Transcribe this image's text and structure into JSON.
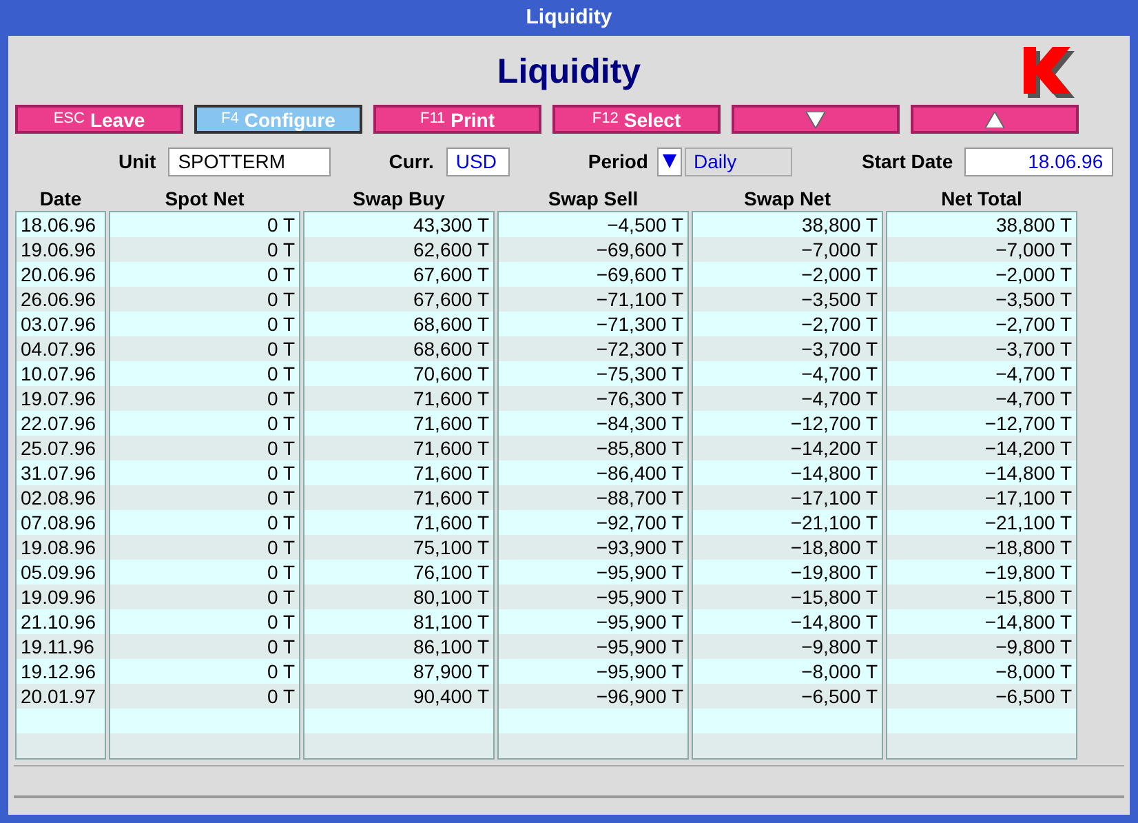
{
  "window": {
    "title": "Liquidity"
  },
  "heading": "Liquidity",
  "buttons": [
    {
      "kind": "text",
      "key": "ESC",
      "label": "Leave",
      "selected": false
    },
    {
      "kind": "text",
      "key": "F4",
      "label": "Configure",
      "selected": true
    },
    {
      "kind": "text",
      "key": "F11",
      "label": "Print",
      "selected": false
    },
    {
      "kind": "text",
      "key": "F12",
      "label": "Select",
      "selected": false
    },
    {
      "kind": "down",
      "selected": false
    },
    {
      "kind": "up",
      "selected": false
    }
  ],
  "fields": {
    "unit": {
      "label": "Unit",
      "value": "SPOTTERM"
    },
    "currency": {
      "label": "Curr.",
      "value": "USD"
    },
    "period": {
      "label": "Period",
      "value": "Daily"
    },
    "start_date": {
      "label": "Start Date",
      "value": "18.06.96"
    }
  },
  "table": {
    "columns": [
      "Date",
      "Spot Net",
      "Swap Buy",
      "Swap Sell",
      "Swap Net",
      "Net Total"
    ],
    "rows": [
      [
        "18.06.96",
        "0 T",
        "43,300 T",
        "−4,500 T",
        "38,800 T",
        "38,800 T"
      ],
      [
        "19.06.96",
        "0 T",
        "62,600 T",
        "−69,600 T",
        "−7,000 T",
        "−7,000 T"
      ],
      [
        "20.06.96",
        "0 T",
        "67,600 T",
        "−69,600 T",
        "−2,000 T",
        "−2,000 T"
      ],
      [
        "26.06.96",
        "0 T",
        "67,600 T",
        "−71,100 T",
        "−3,500 T",
        "−3,500 T"
      ],
      [
        "03.07.96",
        "0 T",
        "68,600 T",
        "−71,300 T",
        "−2,700 T",
        "−2,700 T"
      ],
      [
        "04.07.96",
        "0 T",
        "68,600 T",
        "−72,300 T",
        "−3,700 T",
        "−3,700 T"
      ],
      [
        "10.07.96",
        "0 T",
        "70,600 T",
        "−75,300 T",
        "−4,700 T",
        "−4,700 T"
      ],
      [
        "19.07.96",
        "0 T",
        "71,600 T",
        "−76,300 T",
        "−4,700 T",
        "−4,700 T"
      ],
      [
        "22.07.96",
        "0 T",
        "71,600 T",
        "−84,300 T",
        "−12,700 T",
        "−12,700 T"
      ],
      [
        "25.07.96",
        "0 T",
        "71,600 T",
        "−85,800 T",
        "−14,200 T",
        "−14,200 T"
      ],
      [
        "31.07.96",
        "0 T",
        "71,600 T",
        "−86,400 T",
        "−14,800 T",
        "−14,800 T"
      ],
      [
        "02.08.96",
        "0 T",
        "71,600 T",
        "−88,700 T",
        "−17,100 T",
        "−17,100 T"
      ],
      [
        "07.08.96",
        "0 T",
        "71,600 T",
        "−92,700 T",
        "−21,100 T",
        "−21,100 T"
      ],
      [
        "19.08.96",
        "0 T",
        "75,100 T",
        "−93,900 T",
        "−18,800 T",
        "−18,800 T"
      ],
      [
        "05.09.96",
        "0 T",
        "76,100 T",
        "−95,900 T",
        "−19,800 T",
        "−19,800 T"
      ],
      [
        "19.09.96",
        "0 T",
        "80,100 T",
        "−95,900 T",
        "−15,800 T",
        "−15,800 T"
      ],
      [
        "21.10.96",
        "0 T",
        "81,100 T",
        "−95,900 T",
        "−14,800 T",
        "−14,800 T"
      ],
      [
        "19.11.96",
        "0 T",
        "86,100 T",
        "−95,900 T",
        "−9,800 T",
        "−9,800 T"
      ],
      [
        "19.12.96",
        "0 T",
        "87,900 T",
        "−95,900 T",
        "−8,000 T",
        "−8,000 T"
      ],
      [
        "20.01.97",
        "0 T",
        "90,400 T",
        "−96,900 T",
        "−6,500 T",
        "−6,500 T"
      ]
    ]
  }
}
